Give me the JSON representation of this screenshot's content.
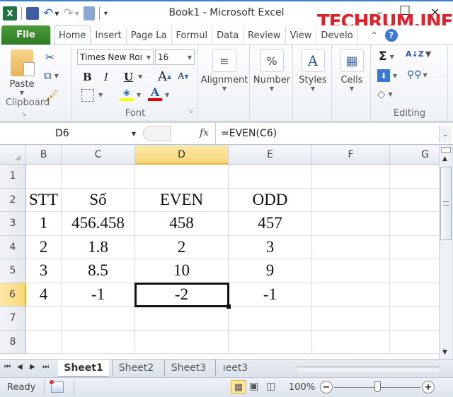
{
  "window": {
    "title": "Book1  -  Microsoft Excel",
    "minimize": "–",
    "maximize": "☐",
    "close": "✕",
    "watermark": "TECHRUM.INFO"
  },
  "qat": {
    "app_icon": "excel-icon",
    "save": "save-icon",
    "undo": "undo-icon",
    "redo": "redo-icon",
    "calc": "calculator-icon",
    "customize": "customize-qat-icon"
  },
  "tabs": [
    "File",
    "Home",
    "Insert",
    "Page La",
    "Formul",
    "Data",
    "Review",
    "View",
    "Develo"
  ],
  "active_tab": "Home",
  "ribbon": {
    "clipboard": {
      "label": "Clipboard",
      "paste": "Paste"
    },
    "font": {
      "label": "Font",
      "name": "Times New Roı",
      "size": "16",
      "bold": "B",
      "italic": "I",
      "underline": "U",
      "grow": "A",
      "shrink": "A",
      "font_color": "A",
      "fill_color_hex": "#ffff00",
      "font_color_hex": "#e00000"
    },
    "alignment": {
      "label": "Alignment",
      "icon": "≡"
    },
    "number": {
      "label": "Number",
      "icon": "%"
    },
    "styles": {
      "label": "Styles",
      "icon": "A"
    },
    "cells": {
      "label": "Cells",
      "icon": "▦"
    },
    "editing": {
      "label": "Editing",
      "autosum": "Σ",
      "sort": "A↓Z",
      "fill": "⬇",
      "find": "🔭",
      "clear": "◇"
    }
  },
  "formula_bar": {
    "name_box": "D6",
    "fx": "fx",
    "formula": "=EVEN(C6)"
  },
  "grid": {
    "columns": [
      "B",
      "C",
      "D",
      "E",
      "F",
      "G"
    ],
    "rows": [
      "1",
      "2",
      "3",
      "4",
      "5",
      "6",
      "7",
      "8"
    ],
    "selected_col": "D",
    "selected_row": "6",
    "cells": [
      [
        "",
        "",
        "",
        "",
        "",
        ""
      ],
      [
        "STT",
        "Số",
        "EVEN",
        "ODD",
        "",
        ""
      ],
      [
        "1",
        "456.458",
        "458",
        "457",
        "",
        ""
      ],
      [
        "2",
        "1.8",
        "2",
        "3",
        "",
        ""
      ],
      [
        "3",
        "8.5",
        "10",
        "9",
        "",
        ""
      ],
      [
        "4",
        "-1",
        "-2",
        "-1",
        "",
        ""
      ],
      [
        "",
        "",
        "",
        "",
        "",
        ""
      ],
      [
        "",
        "",
        "",
        "",
        "",
        ""
      ]
    ]
  },
  "sheets": {
    "tabs": [
      "Sheet1",
      "Sheet2",
      "Sheet3",
      "ıeet3"
    ],
    "active": "Sheet1",
    "nav": [
      "⏮",
      "◀",
      "▶",
      "⏭"
    ]
  },
  "status": {
    "ready": "Ready",
    "zoom": "100%",
    "zoom_out": "−",
    "zoom_in": "+",
    "zoom_level_fraction": 0.5
  }
}
